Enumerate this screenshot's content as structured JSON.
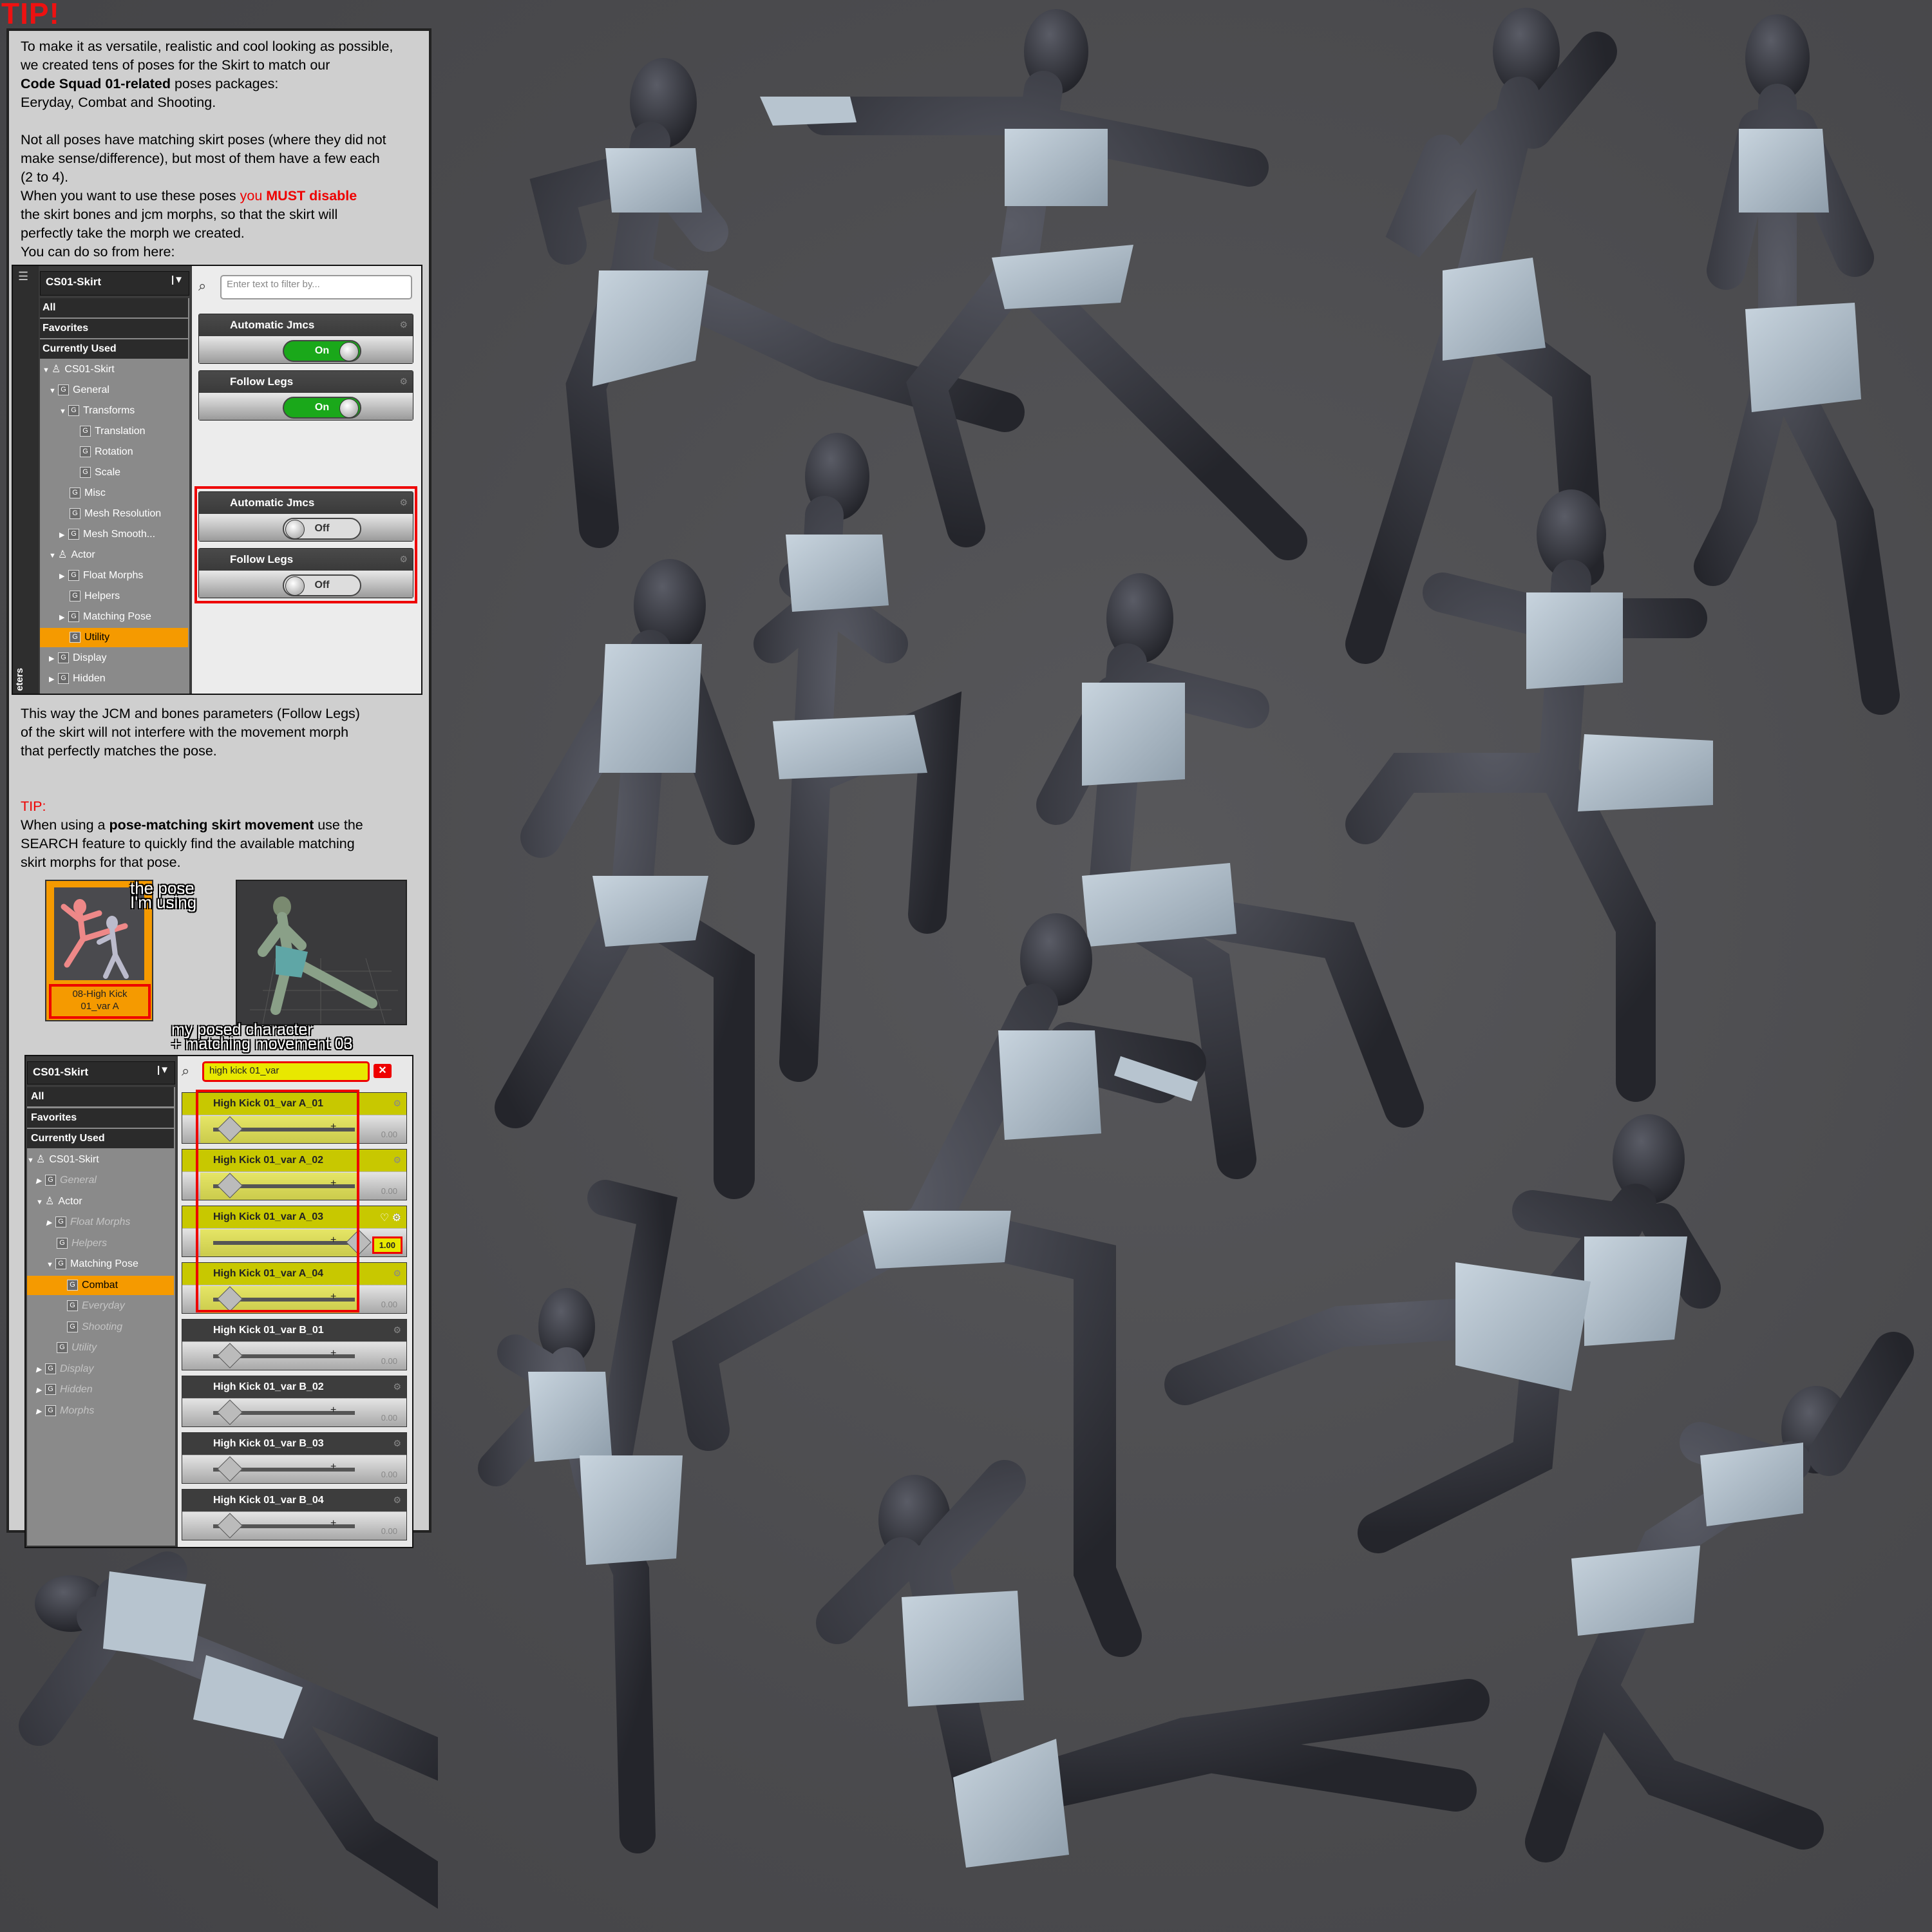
{
  "tip_title": "TIP!",
  "intro": {
    "l1": "To make it as versatile, realistic and cool looking as possible,",
    "l2": "we created tens of poses for the Skirt to match our",
    "l3_bold": "Code Squad 01-related",
    "l3_rest": " poses packages:",
    "l4": "Eeryday, Combat and Shooting.",
    "l5": "Not all poses have matching skirt poses (where they did not",
    "l6": "make sense/difference), but most of them have a few each",
    "l7": "(2 to 4).",
    "l8a": "When you want to use these poses ",
    "l8_red": "you ",
    "l8_redbold": "MUST disable",
    "l9": "the skirt bones and jcm morphs, so that the skirt will",
    "l10": "perfectly take the morph we created.",
    "l11": " You can do so from here:"
  },
  "ui1": {
    "dropdown": "CS01-Skirt",
    "search_placeholder": "Enter text to filter by...",
    "side_tab": "eters",
    "tree": [
      "All",
      "Favorites",
      "Currently Used",
      "CS01-Skirt",
      "General",
      "Transforms",
      "Translation",
      "Rotation",
      "Scale",
      "Misc",
      "Mesh Resolution",
      "Mesh Smooth...",
      "Actor",
      "Float Morphs",
      "Helpers",
      "Matching Pose",
      "Utility",
      "Display",
      "Hidden"
    ],
    "props": [
      {
        "label": "Automatic Jmcs",
        "state": "On"
      },
      {
        "label": "Follow Legs",
        "state": "On"
      },
      {
        "label": "Automatic Jmcs",
        "state": "Off"
      },
      {
        "label": "Follow Legs",
        "state": "Off"
      }
    ]
  },
  "mid_text": {
    "l1": "This way the JCM and bones parameters (Follow Legs)",
    "l2": "of the skirt will not interfere with the movement morph",
    "l3": "that perfectly matches the pose."
  },
  "tip2": {
    "title": "TIP:",
    "l1a": "When using a ",
    "l1_bold": "pose-matching skirt movement",
    "l1b": " use the",
    "l2": "SEARCH feature to quickly find the available matching",
    "l3": "skirt morphs for that pose."
  },
  "thumbs": {
    "pose_label_1": "08-High Kick",
    "pose_label_2": "01_var A",
    "anno_pose_1": "the pose",
    "anno_pose_2": "I'm using",
    "anno_char_1": "my posed character",
    "anno_char_2": "+ matching movement 03"
  },
  "ui2": {
    "dropdown": "CS01-Skirt",
    "search_value": "high kick 01_var",
    "tree": [
      "All",
      "Favorites",
      "Currently Used",
      "CS01-Skirt",
      "General",
      "Actor",
      "Float Morphs",
      "Helpers",
      "Matching Pose",
      "Combat",
      "Everyday",
      "Shooting",
      "Utility",
      "Display",
      "Hidden",
      "Morphs"
    ],
    "sliders": [
      {
        "label": "High Kick 01_var A_01",
        "value": "0.00"
      },
      {
        "label": "High Kick 01_var A_02",
        "value": "0.00"
      },
      {
        "label": "High Kick 01_var A_03",
        "value": "1.00"
      },
      {
        "label": "High Kick 01_var A_04",
        "value": "0.00"
      },
      {
        "label": "High Kick 01_var B_01",
        "value": "0.00"
      },
      {
        "label": "High Kick 01_var B_02",
        "value": "0.00"
      },
      {
        "label": "High Kick 01_var B_03",
        "value": "0.00"
      },
      {
        "label": "High Kick 01_var B_04",
        "value": "0.00"
      }
    ]
  },
  "colors": {
    "accent_red": "#ee0000",
    "toggle_on": "#1aa81a",
    "selection": "#f59a00",
    "highlight": "#e8e800",
    "figure_body": "#2e2f36",
    "figure_skirt": "#aebdc9"
  }
}
